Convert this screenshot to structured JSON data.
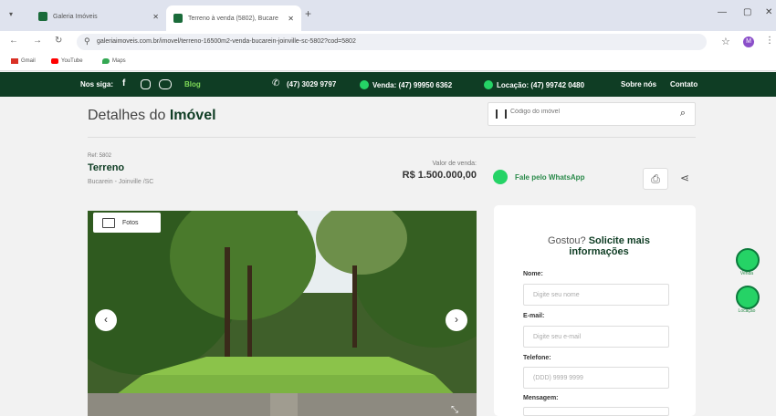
{
  "browser": {
    "tabs": [
      {
        "title": "Galeria Imóveis"
      },
      {
        "title": "Terreno à venda (5802), Bucare"
      }
    ],
    "url": "galeriaimoveis.com.br/imovel/terreno-16500m2-venda-bucarein-joinville-sc-5802?cod=5802",
    "profile_initial": "M",
    "bookmarks": [
      {
        "label": "Gmail",
        "icon": "gmail-icon",
        "color": "#d93025"
      },
      {
        "label": "YouTube",
        "icon": "youtube-icon",
        "color": "#ff0000"
      },
      {
        "label": "Maps",
        "icon": "maps-icon",
        "color": "#34a853"
      }
    ]
  },
  "site_header": {
    "follow_label": "Nos siga:",
    "blog": "Blog",
    "phone": "(47) 3029 9797",
    "sales": "Venda: (47) 99950 6362",
    "rental": "Locação: (47) 99742 0480",
    "about": "Sobre nós",
    "contact": "Contato"
  },
  "page": {
    "title_light": "Detalhes do",
    "title_bold": "Imóvel",
    "search_placeholder": "Código do imóvel"
  },
  "property": {
    "ref": "Ref: 5802",
    "type": "Terreno",
    "location": "Bucarein - Joinville /SC",
    "price_label": "Valor de venda:",
    "price": "R$ 1.500.000,00",
    "whatsapp_label": "Fale pelo WhatsApp",
    "photos_label": "Fotos"
  },
  "form": {
    "heading_light": "Gostou?",
    "heading_bold": "Solicite mais informações",
    "fields": [
      {
        "label": "Nome:",
        "placeholder": "Digite seu nome"
      },
      {
        "label": "E-mail:",
        "placeholder": "Digite seu e-mail"
      },
      {
        "label": "Telefone:",
        "placeholder": "(DDD) 9999 9999"
      },
      {
        "label": "Mensagem:"
      }
    ]
  },
  "floating": [
    {
      "label": "Venda"
    },
    {
      "label": "Locação"
    }
  ],
  "colors": {
    "brand_green": "#0f3d24",
    "whatsapp": "#25d366"
  }
}
